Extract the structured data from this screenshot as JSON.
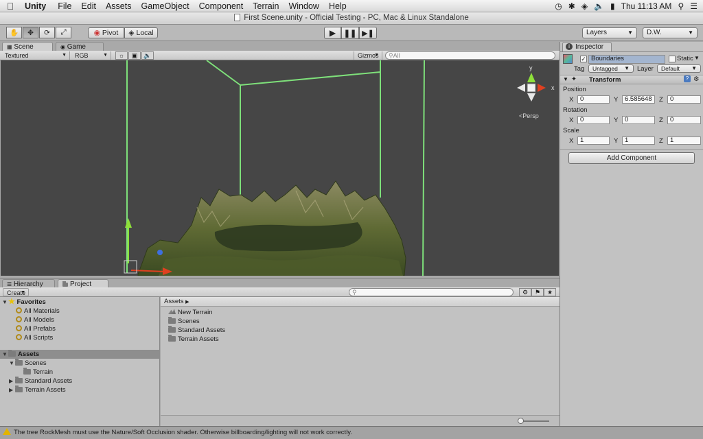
{
  "menubar": {
    "app": "Unity",
    "menus": [
      "File",
      "Edit",
      "Assets",
      "GameObject",
      "Component",
      "Terrain",
      "Window",
      "Help"
    ],
    "clock": "Thu 11:13 AM"
  },
  "window": {
    "title": "First Scene.unity - Official Testing - PC, Mac & Linux Standalone"
  },
  "toolbar": {
    "pivot": "Pivot",
    "local": "Local",
    "layers": "Layers",
    "layout": "D.W."
  },
  "scene": {
    "tab_scene": "Scene",
    "tab_game": "Game",
    "render_mode": "Textured",
    "color_mode": "RGB",
    "gizmos": "Gizmos",
    "search_placeholder": "All",
    "gizmo_y": "y",
    "gizmo_x": "x",
    "persp": "Persp"
  },
  "inspector": {
    "tab": "Inspector",
    "object_name": "Boundaries",
    "static_label": "Static",
    "tag_label": "Tag",
    "tag_value": "Untagged",
    "layer_label": "Layer",
    "layer_value": "Default",
    "component": "Transform",
    "position_label": "Position",
    "rotation_label": "Rotation",
    "scale_label": "Scale",
    "position": {
      "x": "0",
      "y": "6.585648",
      "z": "0"
    },
    "rotation": {
      "x": "0",
      "y": "0",
      "z": "0"
    },
    "scale": {
      "x": "1",
      "y": "1",
      "z": "1"
    },
    "add_component": "Add Component"
  },
  "project": {
    "tab_hierarchy": "Hierarchy",
    "tab_project": "Project",
    "create": "Create",
    "favorites": "Favorites",
    "favorite_items": [
      "All Materials",
      "All Models",
      "All Prefabs",
      "All Scripts"
    ],
    "assets_root": "Assets",
    "tree": [
      "Scenes",
      "Terrain",
      "Standard Assets",
      "Terrain Assets"
    ],
    "assets_header": "Assets",
    "asset_items": [
      "New Terrain",
      "Scenes",
      "Standard Assets",
      "Terrain Assets"
    ]
  },
  "status": {
    "message": "The tree RockMesh must use the Nature/Soft Occlusion shader. Otherwise billboarding/lighting will not work correctly."
  },
  "colors": {
    "scene_bg": "#464646",
    "bound_line": "#7ee07a",
    "selection": "#a3b5cf"
  }
}
